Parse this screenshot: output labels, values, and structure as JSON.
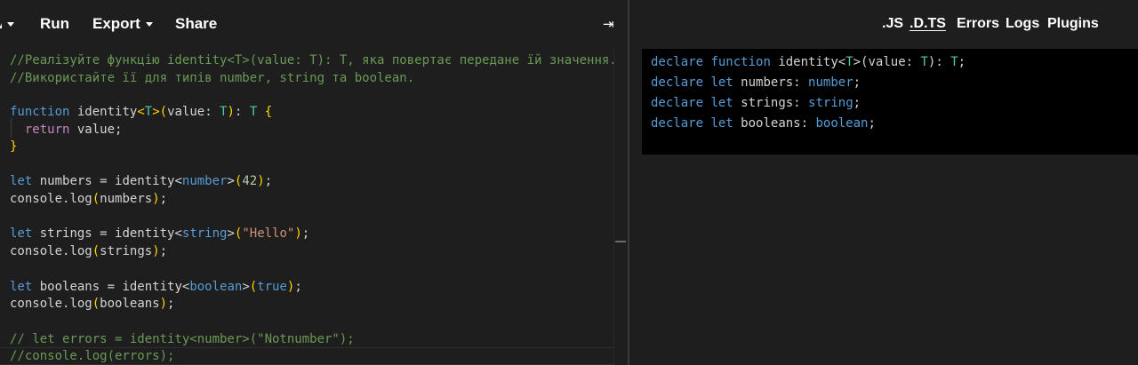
{
  "toolbar": {
    "version_glyph": "v",
    "run_label": "Run",
    "export_label": "Export",
    "share_label": "Share",
    "collapse_glyph": "⇥"
  },
  "editor": {
    "line_1": "//Реалізуйте функцію identity<T>(value: T): T, яка повертає передане їй значення.",
    "line_2": "//Використайте її для типів number, string та boolean.",
    "line_4": {
      "k1": "function",
      "s1": " ",
      "id1": "identity",
      "lt": "<",
      "t1": "T",
      "gt": ">",
      "p_open": "(",
      "id2": "value",
      "colon1": ": ",
      "t2": "T",
      "p_close": ")",
      "colon2": ": ",
      "t3": "T",
      "s2": " ",
      "brace": "{"
    },
    "line_5": {
      "indent": "  ",
      "k1": "return",
      "rest": " value;"
    },
    "line_6": {
      "brace": "}"
    },
    "line_8": {
      "k1": "let",
      "rest1": " numbers = identity",
      "lt": "<",
      "t1": "number",
      "gt": ">",
      "p_open": "(",
      "num": "42",
      "p_close": ")",
      "semi": ";"
    },
    "line_9": {
      "pre": "console.",
      "fn": "log",
      "p_open": "(",
      "arg": "numbers",
      "p_close": ")",
      "semi": ";"
    },
    "line_11": {
      "k1": "let",
      "rest1": " strings = identity",
      "lt": "<",
      "t1": "string",
      "gt": ">",
      "p_open": "(",
      "str": "\"Hello\"",
      "p_close": ")",
      "semi": ";"
    },
    "line_12": {
      "pre": "console.",
      "fn": "log",
      "p_open": "(",
      "arg": "strings",
      "p_close": ")",
      "semi": ";"
    },
    "line_14": {
      "k1": "let",
      "rest1": " booleans = identity",
      "lt": "<",
      "t1": "boolean",
      "gt": ">",
      "p_open": "(",
      "bool": "true",
      "p_close": ")",
      "semi": ";"
    },
    "line_15": {
      "pre": "console.",
      "fn": "log",
      "p_open": "(",
      "arg": "booleans",
      "p_close": ")",
      "semi": ";"
    },
    "line_17": "// let errors = identity<number>(\"Notnumber\");",
    "line_18": "//console.log(errors);"
  },
  "output_tabs": {
    "js": ".JS",
    "dts": ".D.TS",
    "errors": "Errors",
    "logs": "Logs",
    "plugins": "Plugins",
    "active": ".D.TS"
  },
  "dts_output": {
    "line_1": {
      "k1": "declare",
      "s1": " ",
      "k2": "function",
      "rest": " identity<",
      "t1": "T",
      "mid": ">(value: ",
      "t2": "T",
      "mid2": "): ",
      "t3": "T",
      "end": ";"
    },
    "line_2": {
      "k1": "declare",
      "s1": " ",
      "k2": "let",
      "rest": " numbers: ",
      "t1": "number",
      "end": ";"
    },
    "line_3": {
      "k1": "declare",
      "s1": " ",
      "k2": "let",
      "rest": " strings: ",
      "t1": "string",
      "end": ";"
    },
    "line_4": {
      "k1": "declare",
      "s1": " ",
      "k2": "let",
      "rest": " booleans: ",
      "t1": "boolean",
      "end": ";"
    }
  },
  "colors": {
    "background": "#1e1e1e",
    "comment": "#6a9955",
    "keyword": "#569cd6",
    "type": "#4ec9b0",
    "string": "#ce9178",
    "number": "#b5cea8",
    "bracket_level_1": "#ffd700",
    "bracket_level_2": "#da70d6",
    "output_background": "#000000"
  }
}
